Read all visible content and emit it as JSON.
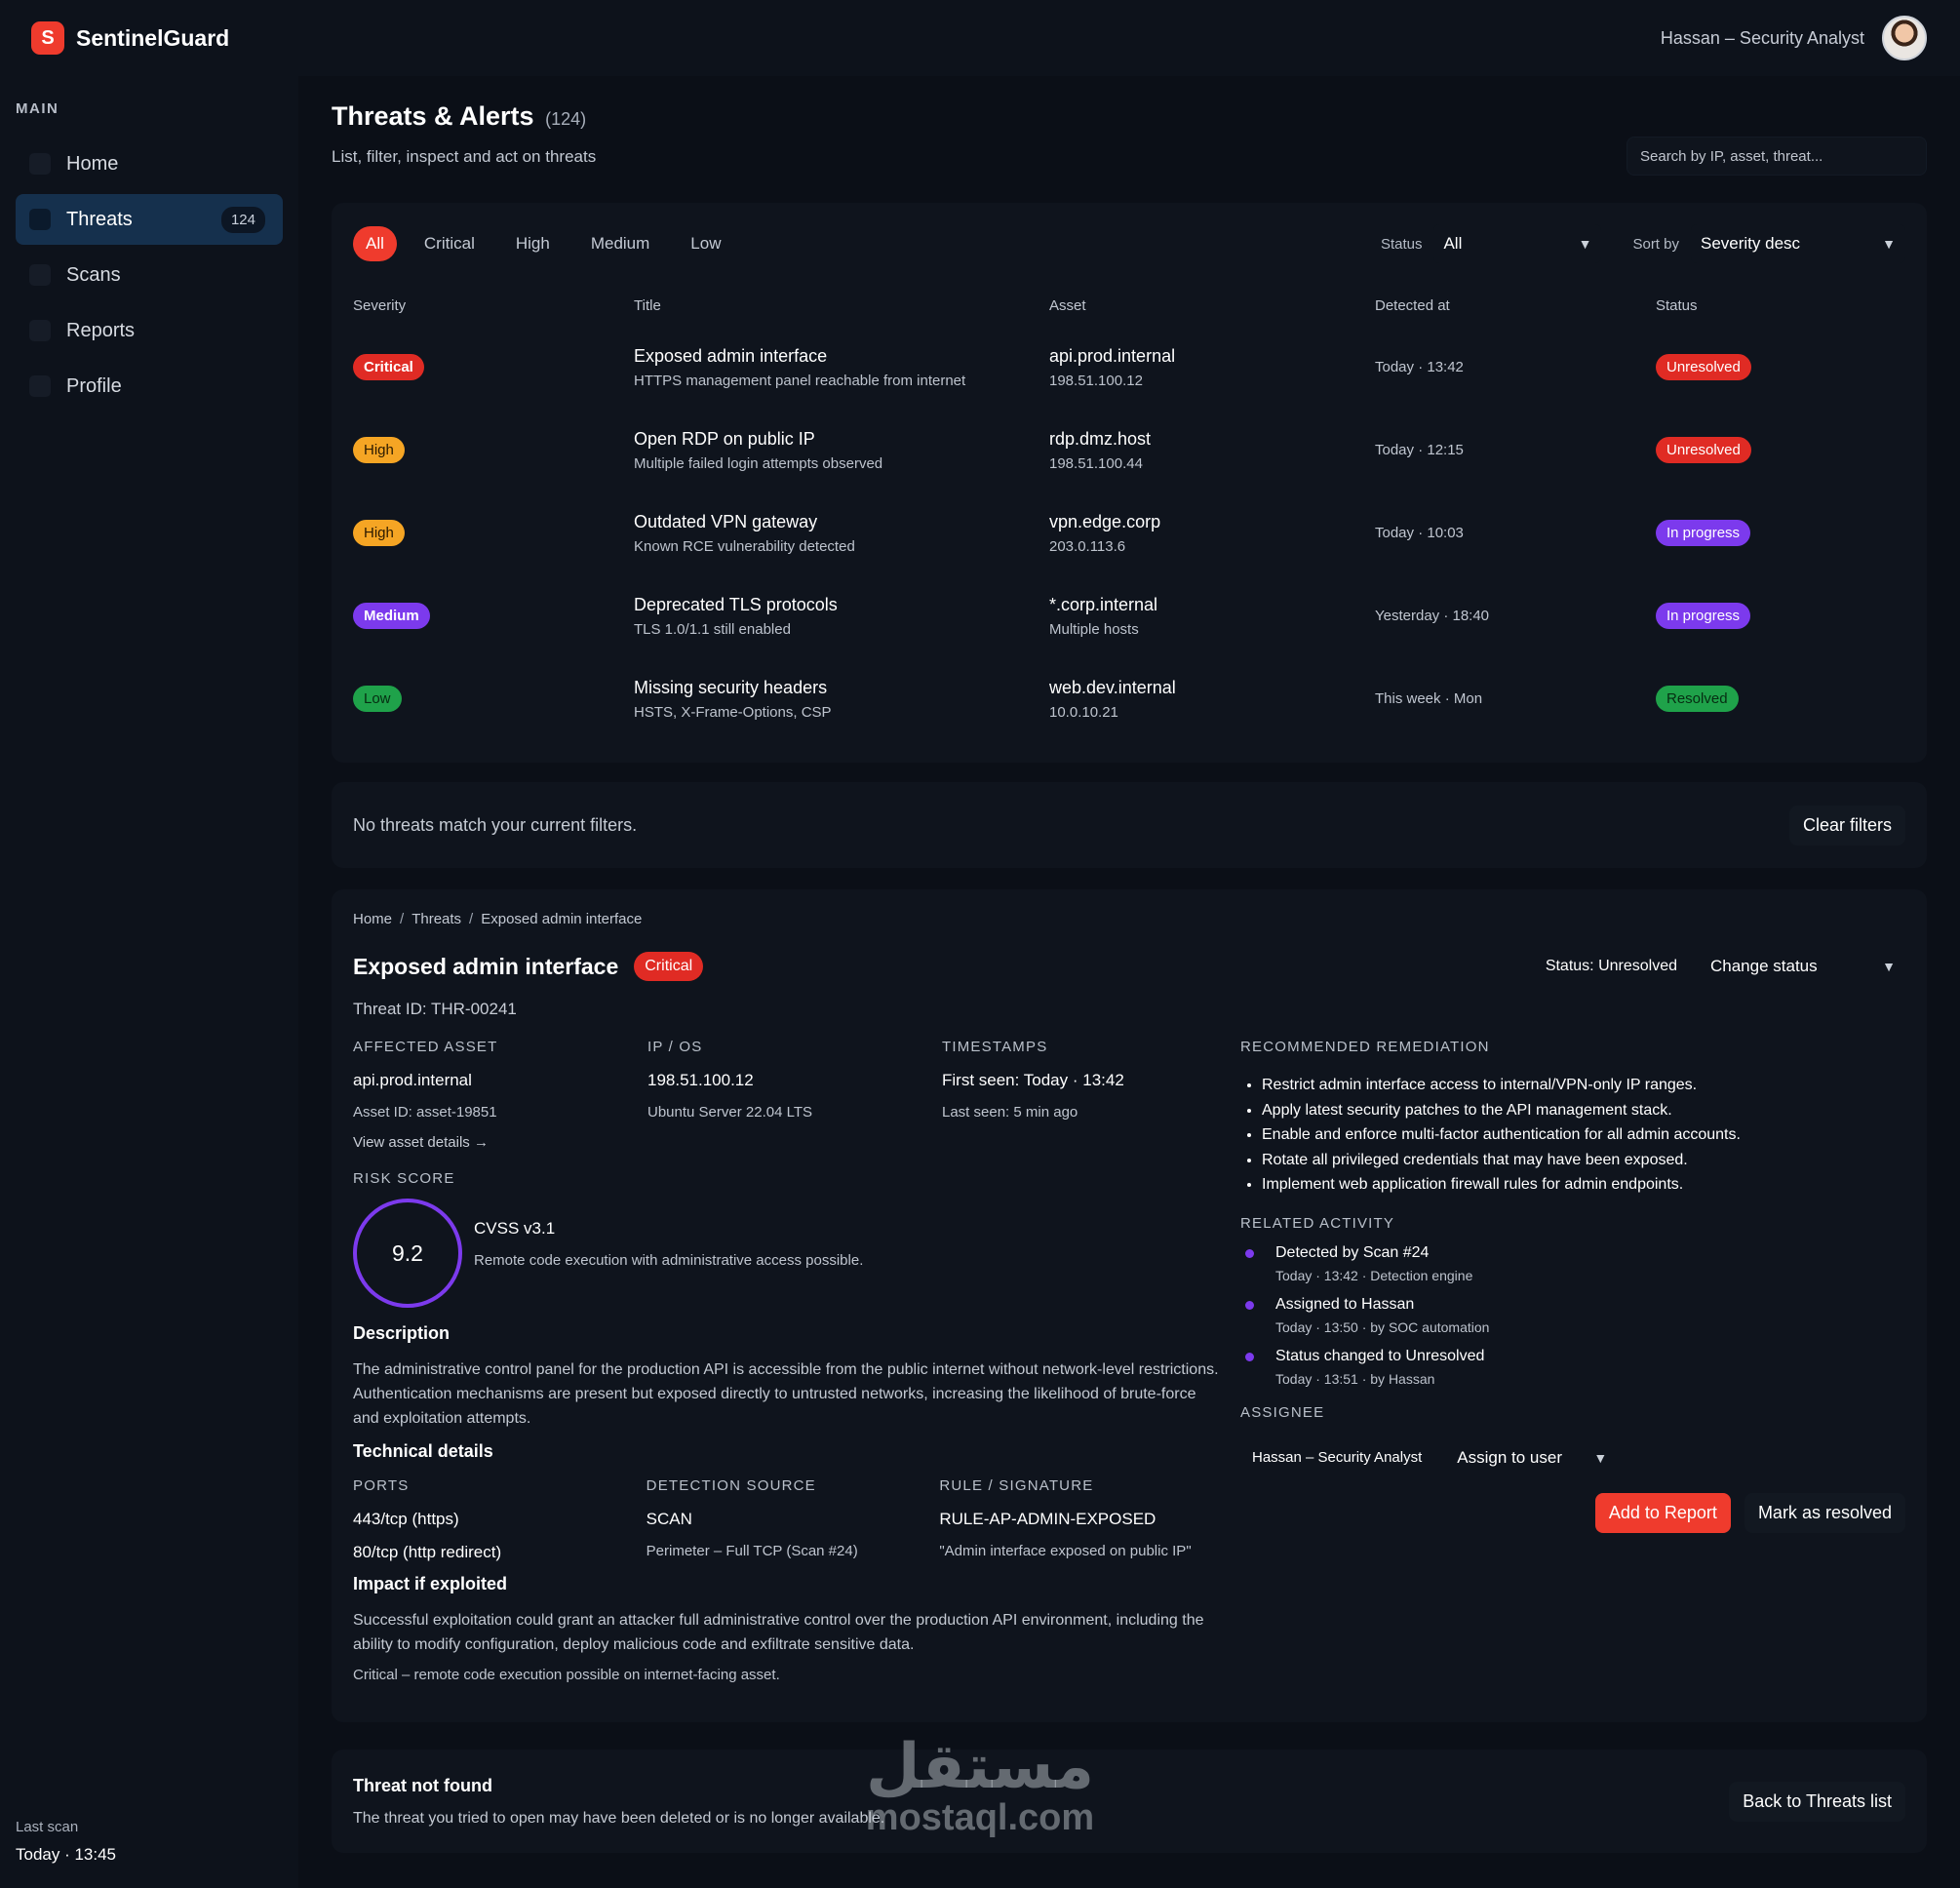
{
  "app": {
    "logo_letter": "S",
    "name": "SentinelGuard"
  },
  "user": {
    "name": "Hassan – Security Analyst"
  },
  "sidebar": {
    "section": "MAIN",
    "items": [
      {
        "label": "Home"
      },
      {
        "label": "Threats",
        "badge": "124",
        "active": true
      },
      {
        "label": "Scans"
      },
      {
        "label": "Reports"
      },
      {
        "label": "Profile"
      }
    ],
    "last_scan_label": "Last scan",
    "last_scan_value": "Today · 13:45"
  },
  "page": {
    "title": "Threats & Alerts",
    "count": "(124)",
    "subtitle": "List, filter, inspect and act on threats",
    "search_placeholder": "Search by IP, asset, threat..."
  },
  "filters": {
    "chips": [
      "All",
      "Critical",
      "High",
      "Medium",
      "Low"
    ],
    "active_chip": "All",
    "status_label": "Status",
    "status_value": "All",
    "sort_label": "Sort by",
    "sort_value": "Severity desc"
  },
  "table": {
    "headers": [
      "Severity",
      "Title",
      "Asset",
      "Detected at",
      "Status"
    ],
    "rows": [
      {
        "severity": "Critical",
        "title": "Exposed admin interface",
        "subtitle": "HTTPS management panel reachable from internet",
        "asset": "api.prod.internal",
        "asset_ip": "198.51.100.12",
        "detected": "Today · 13:42",
        "status": "Unresolved"
      },
      {
        "severity": "High",
        "title": "Open RDP on public IP",
        "subtitle": "Multiple failed login attempts observed",
        "asset": "rdp.dmz.host",
        "asset_ip": "198.51.100.44",
        "detected": "Today · 12:15",
        "status": "Unresolved"
      },
      {
        "severity": "High",
        "title": "Outdated VPN gateway",
        "subtitle": "Known RCE vulnerability detected",
        "asset": "vpn.edge.corp",
        "asset_ip": "203.0.113.6",
        "detected": "Today · 10:03",
        "status": "In progress"
      },
      {
        "severity": "Medium",
        "title": "Deprecated TLS protocols",
        "subtitle": "TLS 1.0/1.1 still enabled",
        "asset": "*.corp.internal",
        "asset_ip": "Multiple hosts",
        "detected": "Yesterday · 18:40",
        "status": "In progress"
      },
      {
        "severity": "Low",
        "title": "Missing security headers",
        "subtitle": "HSTS, X-Frame-Options, CSP",
        "asset": "web.dev.internal",
        "asset_ip": "10.0.10.21",
        "detected": "This week · Mon",
        "status": "Resolved"
      }
    ]
  },
  "empty": {
    "text": "No threats match your current filters.",
    "button": "Clear filters"
  },
  "detail": {
    "breadcrumb": [
      "Home",
      "Threats",
      "Exposed admin interface"
    ],
    "title": "Exposed admin interface",
    "severity": "Critical",
    "status_text": "Status: Unresolved",
    "change_status": "Change status",
    "threat_id": "Threat ID: THR-00241",
    "affected_asset": {
      "label": "AFFECTED ASSET",
      "value": "api.prod.internal",
      "sub": "Asset ID: asset-19851",
      "link": "View asset details →"
    },
    "ip_os": {
      "label": "IP / OS",
      "value": "198.51.100.12",
      "sub": "Ubuntu Server 22.04 LTS"
    },
    "timestamps": {
      "label": "TIMESTAMPS",
      "value": "First seen: Today · 13:42",
      "sub": "Last seen: 5 min ago"
    },
    "risk": {
      "label": "RISK SCORE",
      "score": "9.2",
      "name": "CVSS v3.1",
      "desc": "Remote code execution with administrative access possible."
    },
    "description": {
      "label": "Description",
      "text": "The administrative control panel for the production API is accessible from the public internet without network-level restrictions. Authentication mechanisms are present but exposed directly to untrusted networks, increasing the likelihood of brute-force and exploitation attempts."
    },
    "technical": {
      "label": "Technical details",
      "ports_label": "PORTS",
      "ports": [
        "443/tcp (https)",
        "80/tcp (http redirect)"
      ],
      "source_label": "DETECTION SOURCE",
      "source": "SCAN",
      "source_sub": "Perimeter – Full TCP (Scan #24)",
      "rule_label": "RULE / SIGNATURE",
      "rule": "RULE-AP-ADMIN-EXPOSED",
      "rule_sub": "\"Admin interface exposed on public IP\""
    },
    "impact": {
      "label": "Impact if exploited",
      "text": "Successful exploitation could grant an attacker full administrative control over the production API environment, including the ability to modify configuration, deploy malicious code and exfiltrate sensitive data.",
      "note": "Critical – remote code execution possible on internet-facing asset."
    },
    "remediation": {
      "label": "RECOMMENDED REMEDIATION",
      "items": [
        "Restrict admin interface access to internal/VPN-only IP ranges.",
        "Apply latest security patches to the API management stack.",
        "Enable and enforce multi-factor authentication for all admin accounts.",
        "Rotate all privileged credentials that may have been exposed.",
        "Implement web application firewall rules for admin endpoints."
      ]
    },
    "activity": {
      "label": "RELATED ACTIVITY",
      "items": [
        {
          "title": "Detected by Scan #24",
          "sub": "Today · 13:42 · Detection engine"
        },
        {
          "title": "Assigned to Hassan",
          "sub": "Today · 13:50 · by SOC automation"
        },
        {
          "title": "Status changed to Unresolved",
          "sub": "Today · 13:51 · by Hassan"
        }
      ]
    },
    "assignee": {
      "label": "ASSIGNEE",
      "current": "Hassan – Security Analyst",
      "select": "Assign to user"
    },
    "add_report": "Add to Report",
    "mark_resolved": "Mark as resolved"
  },
  "not_found": {
    "title": "Threat not found",
    "text": "The threat you tried to open may have been deleted or is no longer available.",
    "button": "Back to Threats list"
  },
  "watermark": {
    "arabic": "مستقل",
    "latin": "mostaql.com"
  },
  "colors": {
    "accent": "#ef3b2d",
    "critical": "#e02b24",
    "high": "#f5a524",
    "medium": "#7c3aed",
    "low": "#1fa24a"
  }
}
